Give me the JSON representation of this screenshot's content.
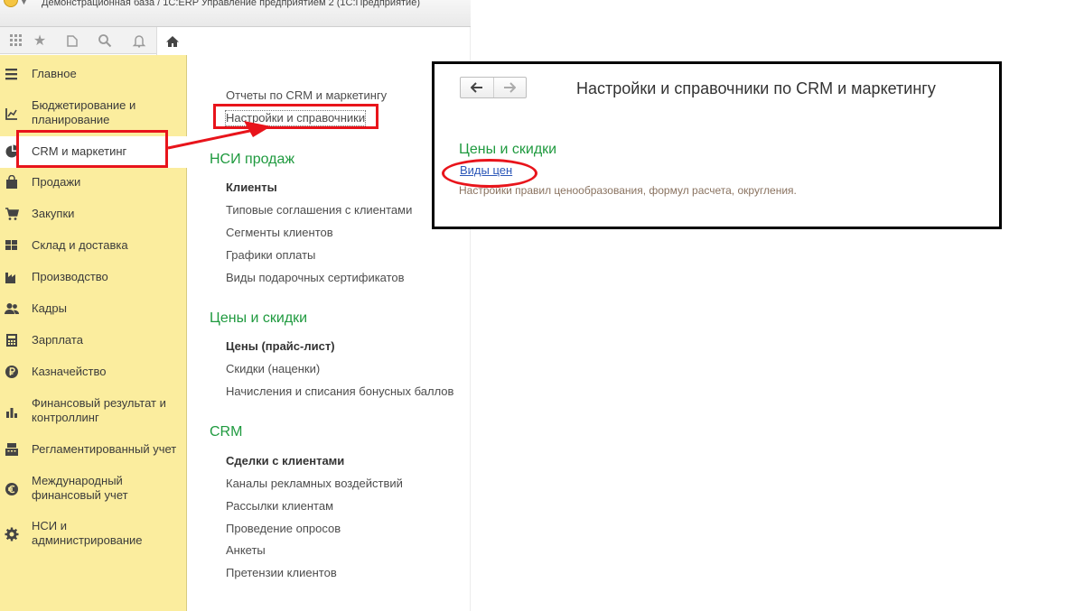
{
  "window": {
    "title": "Демонстрационная база / 1С:ERP Управление предприятием 2  (1С:Предприятие)"
  },
  "toolbar": {
    "icons": [
      "apps-grid-icon",
      "star-icon",
      "history-icon",
      "search-icon",
      "bell-icon",
      "home-icon"
    ]
  },
  "sections": {
    "items": [
      {
        "label": "Главное",
        "icon": "menu-icon"
      },
      {
        "label": "Бюджетирование и планирование",
        "icon": "budget-icon"
      },
      {
        "label": "CRM и маркетинг",
        "icon": "pie-chart-icon",
        "active": true
      },
      {
        "label": "Продажи",
        "icon": "shopping-bag-icon"
      },
      {
        "label": "Закупки",
        "icon": "cart-icon"
      },
      {
        "label": "Склад и доставка",
        "icon": "warehouse-icon"
      },
      {
        "label": "Производство",
        "icon": "factory-icon"
      },
      {
        "label": "Кадры",
        "icon": "people-icon"
      },
      {
        "label": "Зарплата",
        "icon": "calculator-icon"
      },
      {
        "label": "Казначейство",
        "icon": "ruble-icon"
      },
      {
        "label": "Финансовый результат и контроллинг",
        "icon": "bar-chart-icon"
      },
      {
        "label": "Регламентированный учет",
        "icon": "cash-register-icon"
      },
      {
        "label": "Международный финансовый учет",
        "icon": "euro-icon"
      },
      {
        "label": "НСИ и администрирование",
        "icon": "gear-icon"
      }
    ]
  },
  "content": {
    "top_links": [
      "Отчеты по CRM и маркетингу",
      "Настройки и справочники"
    ],
    "groups": [
      {
        "title": "НСИ продаж",
        "items": [
          "Клиенты",
          "Типовые соглашения с клиентами",
          "Сегменты клиентов",
          "Графики оплаты",
          "Виды подарочных сертификатов"
        ]
      },
      {
        "title": "Цены и скидки",
        "items": [
          "Цены (прайс-лист)",
          "Скидки (наценки)",
          "Начисления и списания бонусных баллов"
        ]
      },
      {
        "title": "CRM",
        "items": [
          "Сделки с клиентами",
          "Каналы рекламных воздействий",
          "Рассылки клиентам",
          "Проведение опросов",
          "Анкеты",
          "Претензии клиентов"
        ]
      }
    ]
  },
  "inset": {
    "title": "Настройки и справочники по CRM и маркетингу",
    "group_title": "Цены и скидки",
    "link": "Виды цен",
    "description": "Настройки правил ценообразования, формул расчета, округления."
  },
  "colors": {
    "sections_bg": "#fbed9e",
    "group_heading": "#1f9a3f",
    "annotation_red": "#e8141b",
    "link_blue": "#2b57b8"
  }
}
